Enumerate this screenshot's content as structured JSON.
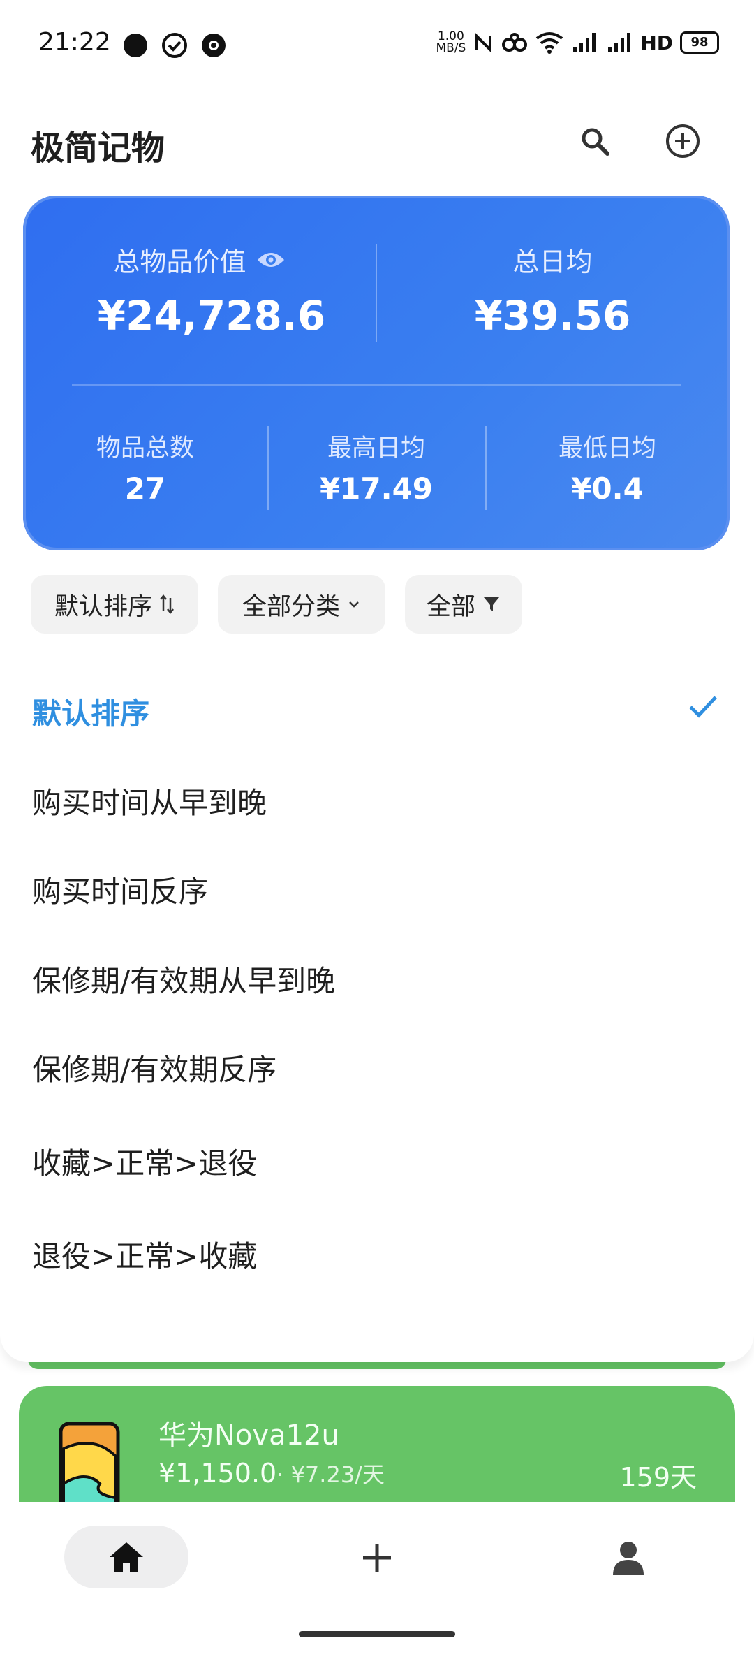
{
  "status_bar": {
    "time": "21:22",
    "net_speed_top": "1.00",
    "net_speed_bottom": "MB/S",
    "hd_label": "HD",
    "battery": "98"
  },
  "header": {
    "title": "极简记物"
  },
  "summary": {
    "total_value_label": "总物品价值",
    "total_value": "¥24,728.6",
    "total_daily_label": "总日均",
    "total_daily": "¥39.56",
    "count_label": "物品总数",
    "count": "27",
    "max_daily_label": "最高日均",
    "max_daily": "¥17.49",
    "min_daily_label": "最低日均",
    "min_daily": "¥0.4"
  },
  "filters": {
    "sort_label": "默认排序",
    "category_label": "全部分类",
    "status_label": "全部"
  },
  "sort_options": [
    "默认排序",
    "购买时间从早到晚",
    "购买时间反序",
    "保修期/有效期从早到晚",
    "保修期/有效期反序",
    "收藏>正常>退役",
    "退役>正常>收藏"
  ],
  "item": {
    "name": "华为Nova12u",
    "price": "¥1,150.0",
    "per_day": " · ¥7.23/天",
    "days": "159天"
  },
  "colors": {
    "accent": "#2f8fe0",
    "card_blue": "#3a7ff0",
    "item_green": "#66c466"
  }
}
